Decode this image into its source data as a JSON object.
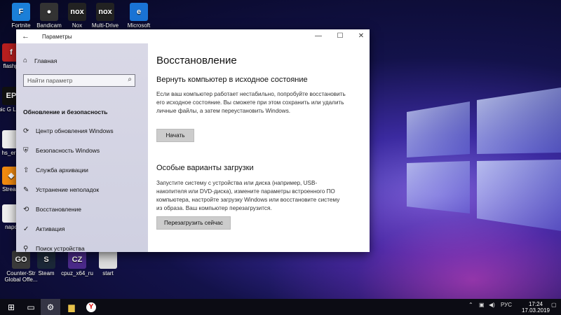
{
  "desktop": {
    "icons_top": [
      {
        "label": "Fortnite",
        "color": "#1b7fd8",
        "glyph": "F"
      },
      {
        "label": "Bandicam",
        "color": "#333333",
        "glyph": "●"
      },
      {
        "label": "Nox",
        "color": "#222222",
        "glyph": "nox"
      },
      {
        "label": "Multi-Drive",
        "color": "#222222",
        "glyph": "nox"
      },
      {
        "label": "Microsoft",
        "color": "#1a73d4",
        "glyph": "e"
      }
    ],
    "icons_left": [
      {
        "label": "flashpl",
        "color": "#b81f1f",
        "glyph": "f"
      },
      {
        "label": "Epic G Launc",
        "color": "#111111",
        "glyph": "EP"
      },
      {
        "label": "hs_err_",
        "color": "#eeeeee",
        "glyph": ""
      },
      {
        "label": "Stream",
        "color": "#f08a10",
        "glyph": "◆"
      },
      {
        "label": "napo",
        "color": "#eeeeee",
        "glyph": ""
      }
    ],
    "icons_bottom": [
      {
        "label": "Counter-Str Global Offe...",
        "color": "#3a3a3a",
        "glyph": "GO"
      },
      {
        "label": "Steam",
        "color": "#1b2838",
        "glyph": "S"
      },
      {
        "label": "cpuz_x64_ru",
        "color": "#4b2a8a",
        "glyph": "CZ"
      },
      {
        "label": "start",
        "color": "#dddddd",
        "glyph": ""
      }
    ]
  },
  "window": {
    "title": "Параметры",
    "back_glyph": "←",
    "minimize_glyph": "—",
    "maximize_glyph": "☐",
    "close_glyph": "✕",
    "sidebar": {
      "home_label": "Главная",
      "search_placeholder": "Найти параметр",
      "section_title": "Обновление и безопасность",
      "items": [
        {
          "label": "Центр обновления Windows",
          "icon": "refresh-icon",
          "glyph": "⟳"
        },
        {
          "label": "Безопасность Windows",
          "icon": "shield-icon",
          "glyph": "⛨"
        },
        {
          "label": "Служба архивации",
          "icon": "backup-icon",
          "glyph": "⇧"
        },
        {
          "label": "Устранение неполадок",
          "icon": "wrench-icon",
          "glyph": "✎"
        },
        {
          "label": "Восстановление",
          "icon": "history-icon",
          "glyph": "⟲"
        },
        {
          "label": "Активация",
          "icon": "check-circle-icon",
          "glyph": "✓"
        },
        {
          "label": "Поиск устройства",
          "icon": "person-icon",
          "glyph": "⚲"
        }
      ]
    },
    "main": {
      "page_title": "Восстановление",
      "reset_heading": "Вернуть компьютер в исходное состояние",
      "reset_text": "Если ваш компьютер работает нестабильно, попробуйте восстановить его исходное состояние. Вы сможете при этом сохранить или удалить личные файлы, а затем переустановить Windows.",
      "reset_button": "Начать",
      "advanced_heading": "Особые варианты загрузки",
      "advanced_text": "Запустите систему с устройства или диска (например, USB-накопителя или DVD-диска), измените параметры встроенного ПО компьютера, настройте загрузку Windows или восстановите систему из образа. Ваш компьютер перезагрузится.",
      "restart_button": "Перезагрузить сейчас"
    }
  },
  "taskbar": {
    "start_glyph": "⊞",
    "tray_language": "РУС",
    "time": "17:24",
    "date": "17.03.2019"
  }
}
